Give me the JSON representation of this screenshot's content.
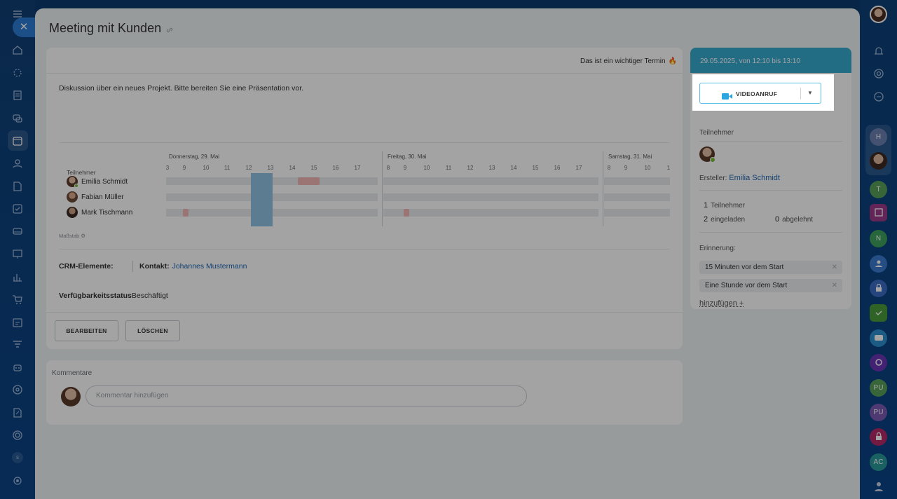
{
  "title": "Meeting mit Kunden",
  "important_note": "Das ist ein wichtiger Termin",
  "description": "Diskussion über ein neues Projekt. Bitte bereiten Sie eine Präsentation vor.",
  "planner": {
    "days": [
      "Donnerstag, 29. Mai",
      "Freitag, 30. Mai",
      "Samstag, 31. Mai"
    ],
    "hours_day1": [
      "3",
      "9",
      "10",
      "11",
      "12",
      "13",
      "14",
      "15",
      "16",
      "17"
    ],
    "hours_day2": [
      "8",
      "9",
      "10",
      "11",
      "12",
      "13",
      "14",
      "15",
      "16",
      "17"
    ],
    "hours_day3": [
      "8",
      "9",
      "10",
      "1"
    ],
    "participants_label": "Teilnehmer",
    "participants": [
      "Emilia Schmidt",
      "Fabian Müller",
      "Mark Tischmann"
    ],
    "scale_label": "Maßstab"
  },
  "crm": {
    "label": "CRM-Elemente:",
    "contact_label": "Kontakt:",
    "contact_name": "Johannes Mustermann"
  },
  "availability": {
    "label": "Verfügbarkeitsstatus",
    "value": "Beschäftigt"
  },
  "buttons": {
    "edit": "BEARBEITEN",
    "delete": "LÖSCHEN"
  },
  "comments": {
    "label": "Kommentare",
    "placeholder": "Kommentar hinzufügen"
  },
  "side": {
    "date": "29.05.2025, von 12:10 bis 13:10",
    "video_button": "VIDEOANRUF",
    "participants_label": "Teilnehmer",
    "creator_label": "Ersteller:",
    "creator_name": "Emilia Schmidt",
    "participants_count": "1",
    "participants_count_label": "Teilnehmer",
    "invited_count": "2",
    "invited_label": "eingeladen",
    "declined_count": "0",
    "declined_label": "abgelehnt",
    "reminder_label": "Erinnerung:",
    "reminders": [
      "15 Minuten vor dem Start",
      "Eine Stunde vor dem Start"
    ],
    "add_label": "hinzufügen +"
  },
  "right_rail_badges": [
    "H",
    "T",
    "N",
    "PU",
    "PU",
    "AC"
  ],
  "left_nav_badge": "s",
  "colors": {
    "accent": "#36a9cf",
    "link": "#2067b0",
    "busy": "#f1b7b4",
    "selection": "#8fc3e3"
  }
}
